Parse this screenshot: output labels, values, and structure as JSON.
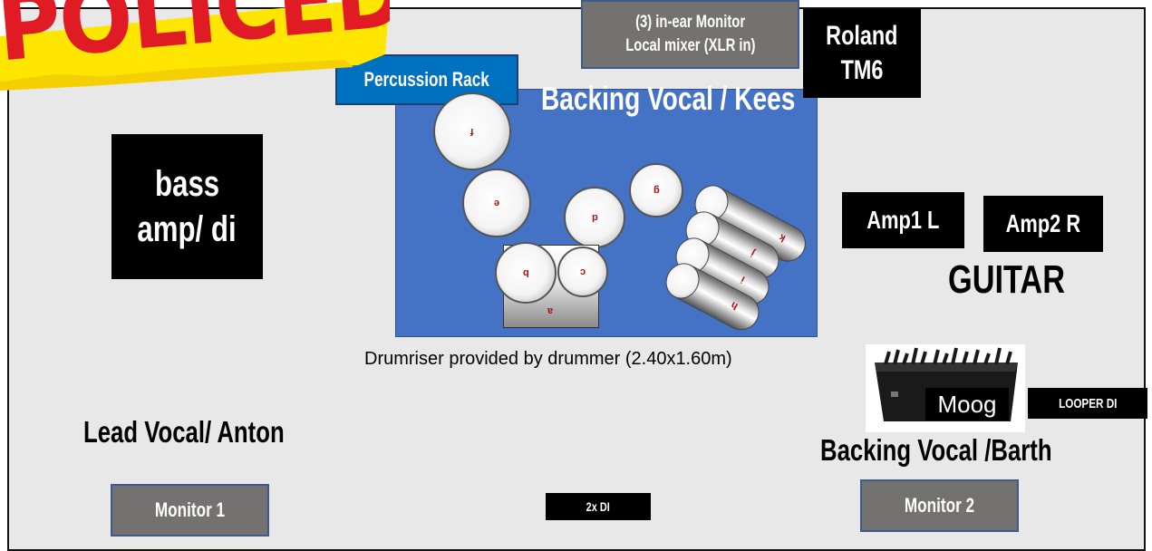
{
  "stamp": "POLICED",
  "labels": {
    "monitor_mixer_line1": "(3) in-ear Monitor",
    "monitor_mixer_line2": "Local mixer (XLR in)",
    "roland_line1": "Roland",
    "roland_line2": "TM6",
    "percussion_rack": "Percussion Rack",
    "backing_vocal_kees": "Backing Vocal / Kees",
    "bass_line1": "bass",
    "bass_line2": "amp/ di",
    "amp1": "Amp1 L",
    "amp2": "Amp2 R",
    "guitar": "GUITAR",
    "drumriser": "Drumriser provided by drummer (2.40x1.60m)",
    "moog": "Moog",
    "looper": "LOOPER DI",
    "lead_vocal": "Lead Vocal/ Anton",
    "backing_vocal_barth": "Backing Vocal /Barth",
    "monitor1": "Monitor 1",
    "monitor2": "Monitor 2",
    "di": "2x DI"
  },
  "drums": {
    "d1": "f",
    "d2": "e",
    "d3": "d",
    "d4": "g",
    "d5": "b",
    "d6": "c",
    "d7": "a",
    "t1": "k",
    "t2": "j",
    "t3": "i",
    "t4": "h"
  },
  "colors": {
    "stage": "#e8e8e8",
    "drum_riser": "#4472c4",
    "percussion_rack": "#0070c0",
    "grey_box": "#747171",
    "black_box": "#000000",
    "stamp_red": "#e01b24",
    "stamp_yellow": "#ffe600"
  }
}
